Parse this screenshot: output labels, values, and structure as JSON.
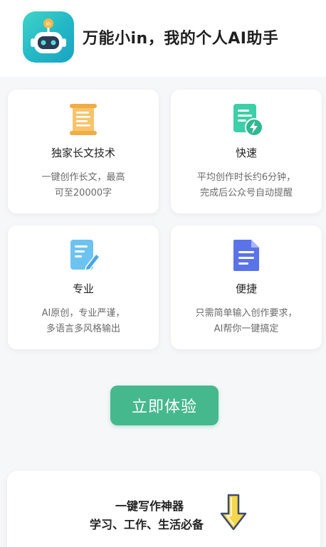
{
  "header": {
    "app_title": "万能小in，我的个人AI助手",
    "logo_badge": "in"
  },
  "features": [
    {
      "title": "独家长文技术",
      "desc": "一键创作长文，最高\n可至20000字",
      "icon": "scroll-icon"
    },
    {
      "title": "快速",
      "desc": "平均创作时长约6分钟，\n完成后公众号自动提醒",
      "icon": "flash-doc-icon"
    },
    {
      "title": "专业",
      "desc": "AI原创，专业严谨，\n多语言多风格输出",
      "icon": "edit-doc-icon"
    },
    {
      "title": "便捷",
      "desc": "只需简单输入创作要求，\nAI帮你一键搞定",
      "icon": "document-icon"
    }
  ],
  "cta": {
    "label": "立即体验"
  },
  "bottom": {
    "line1": "一键写作神器",
    "line2": "学习、工作、生活必备",
    "icon": "down-arrow-icon"
  },
  "colors": {
    "accent": "#46b88e",
    "logo": "#23b7c6",
    "scroll": "#f7c46c",
    "flash": "#3ccfa8",
    "edit": "#6cc3f0",
    "document": "#5b73e8"
  }
}
